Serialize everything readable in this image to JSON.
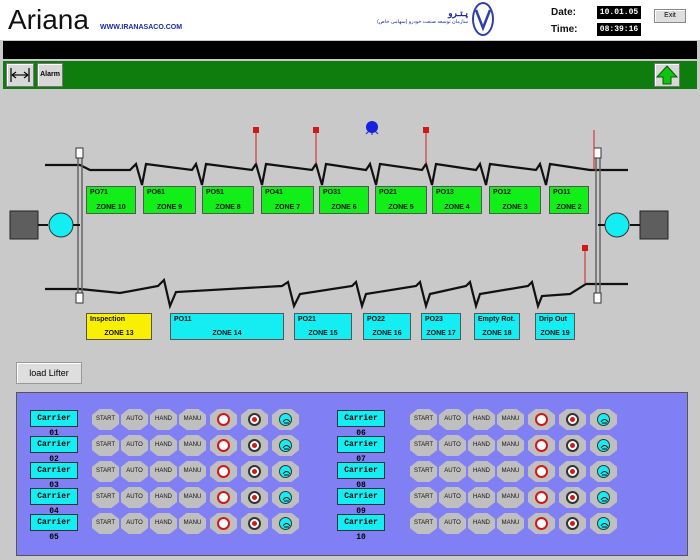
{
  "header": {
    "app_title": "Ariana",
    "website": "WWW.IRANASACO.COM",
    "logo_text": "پـتـرو",
    "logo_subtext": "سازمان توسعه صنعت خودرو (سهامی خاص)",
    "date_label": "Date:",
    "date_value": "10.01.05",
    "time_label": "Time:",
    "time_value": "08:39:16",
    "exit_label": "Exit"
  },
  "toolbar": {
    "width_tool_icon": "width-arrows-icon",
    "alarm_label": "Alarm",
    "home_icon": "up-arrow-icon"
  },
  "zones_upper": [
    {
      "code": "PO71",
      "zone": "ZONE 10"
    },
    {
      "code": "PO61",
      "zone": "ZONE 9"
    },
    {
      "code": "PO51",
      "zone": "ZONE 8"
    },
    {
      "code": "PO41",
      "zone": "ZONE 7"
    },
    {
      "code": "PO31",
      "zone": "ZONE 6"
    },
    {
      "code": "PO21",
      "zone": "ZONE 5"
    },
    {
      "code": "PO13",
      "zone": "ZONE 4"
    },
    {
      "code": "PO12",
      "zone": "ZONE 3"
    },
    {
      "code": "PO11",
      "zone": "ZONE 2"
    }
  ],
  "zones_lower": [
    {
      "code": "Inspection",
      "zone": "ZONE 13",
      "color": "#f8f000"
    },
    {
      "code": "PO11",
      "zone": "ZONE 14",
      "color": "#14eef2"
    },
    {
      "code": "PO21",
      "zone": "ZONE 15",
      "color": "#14eef2"
    },
    {
      "code": "PO22",
      "zone": "ZONE 16",
      "color": "#14eef2"
    },
    {
      "code": "PO23",
      "zone": "ZONE 17",
      "color": "#14eef2"
    },
    {
      "code": "Empty Rot.",
      "zone": "ZONE 18",
      "color": "#14eef2"
    },
    {
      "code": "Drip Out",
      "zone": "ZONE 19",
      "color": "#14eef2"
    }
  ],
  "load_lifter_label": "load Lifter",
  "control_labels": [
    "START",
    "AUTO",
    "HAND",
    "MANU"
  ],
  "carriers_left": [
    "Carrier 01",
    "Carrier 02",
    "Carrier 03",
    "Carrier 04",
    "Carrier 05"
  ],
  "carriers_right": [
    "Carrier 06",
    "Carrier 07",
    "Carrier 08",
    "Carrier 09",
    "Carrier 10"
  ],
  "colors": {
    "zone_green": "#12ef18",
    "zone_cyan": "#14eef2",
    "zone_yellow": "#f8f000",
    "toolbar_green": "#0e7d0e",
    "panel_blue": "#8080f4"
  }
}
